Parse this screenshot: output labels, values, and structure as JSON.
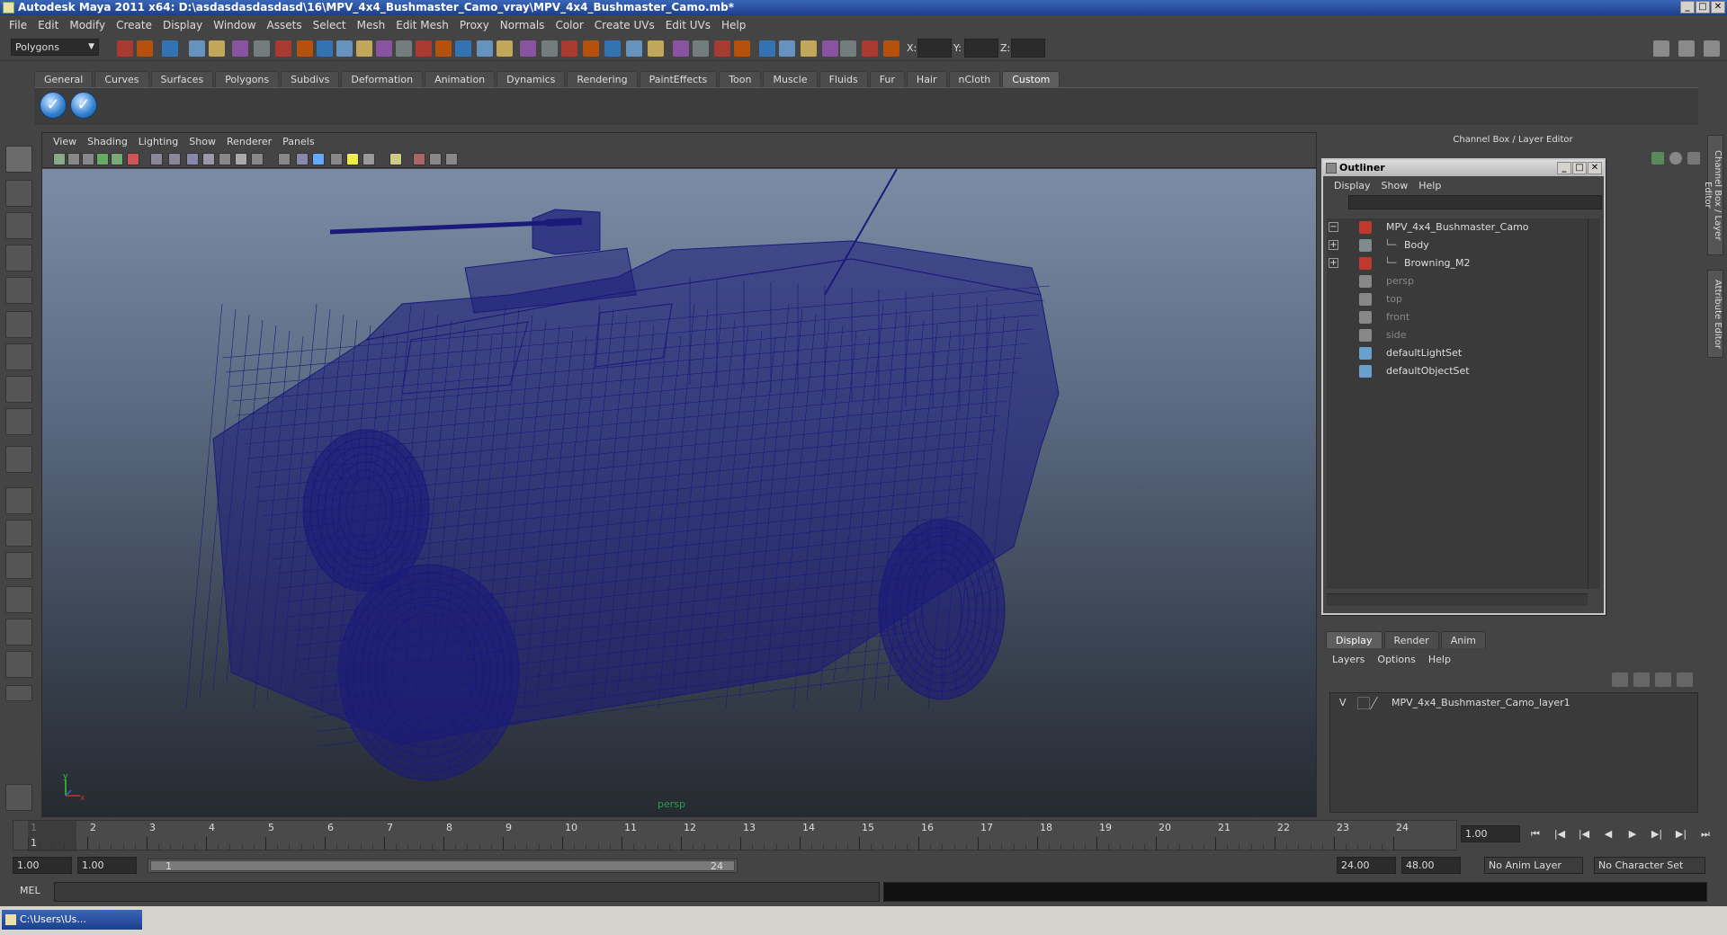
{
  "window": {
    "title": "Autodesk Maya 2011 x64: D:\\asdasdasdasdasd\\16\\MPV_4x4_Bushmaster_Camo_vray\\MPV_4x4_Bushmaster_Camo.mb*",
    "min": "_",
    "max": "□",
    "close": "✕"
  },
  "menubar": [
    "File",
    "Edit",
    "Modify",
    "Create",
    "Display",
    "Window",
    "Assets",
    "Select",
    "Mesh",
    "Edit Mesh",
    "Proxy",
    "Normals",
    "Color",
    "Create UVs",
    "Edit UVs",
    "Help"
  ],
  "status": {
    "mode": "Polygons",
    "x_label": "X:",
    "y_label": "Y:",
    "z_label": "Z:"
  },
  "shelf": {
    "tabs": [
      "General",
      "Curves",
      "Surfaces",
      "Polygons",
      "Subdivs",
      "Deformation",
      "Animation",
      "Dynamics",
      "Rendering",
      "PaintEffects",
      "Toon",
      "Muscle",
      "Fluids",
      "Fur",
      "Hair",
      "nCloth",
      "Custom"
    ],
    "active_tab": "Custom",
    "check_glyph": "✓"
  },
  "viewport": {
    "menu": [
      "View",
      "Shading",
      "Lighting",
      "Show",
      "Renderer",
      "Panels"
    ],
    "camera": "persp",
    "axis_x": "x",
    "axis_y": "y",
    "wire_color": "#1a1a7a"
  },
  "channel_box": {
    "title": "Channel Box / Layer Editor",
    "side_tabs": [
      "Channel Box / Layer Editor",
      "Attribute Editor"
    ]
  },
  "outliner": {
    "title": "Outliner",
    "menu": [
      "Display",
      "Show",
      "Help"
    ],
    "rows": [
      {
        "name": "MPV_4x4_Bushmaster_Camo",
        "expander": "−",
        "dim": false
      },
      {
        "name": "Body",
        "expander": "+",
        "dim": false
      },
      {
        "name": "Browning_M2",
        "expander": "+",
        "dim": false
      },
      {
        "name": "persp",
        "expander": "",
        "dim": true
      },
      {
        "name": "top",
        "expander": "",
        "dim": true
      },
      {
        "name": "front",
        "expander": "",
        "dim": true
      },
      {
        "name": "side",
        "expander": "",
        "dim": true
      },
      {
        "name": "defaultLightSet",
        "expander": "",
        "dim": false
      },
      {
        "name": "defaultObjectSet",
        "expander": "",
        "dim": false
      }
    ]
  },
  "layer_editor": {
    "tabs": [
      "Display",
      "Render",
      "Anim"
    ],
    "active_tab": "Display",
    "menu": [
      "Layers",
      "Options",
      "Help"
    ],
    "layers": [
      {
        "visible": "V",
        "name": "MPV_4x4_Bushmaster_Camo_layer1"
      }
    ]
  },
  "timeline": {
    "ticks": [
      "1",
      "2",
      "3",
      "4",
      "5",
      "6",
      "7",
      "8",
      "9",
      "10",
      "11",
      "12",
      "13",
      "14",
      "15",
      "16",
      "17",
      "18",
      "19",
      "20",
      "21",
      "22",
      "23",
      "24"
    ],
    "current_frame_marker": "1",
    "current_frame": "1.00"
  },
  "range": {
    "start": "1.00",
    "playback_start": "1.00",
    "thumb_start": "1",
    "thumb_end": "24",
    "playback_end": "24.00",
    "end": "48.00",
    "anim_layer": "No Anim Layer",
    "character_set": "No Character Set"
  },
  "command": {
    "label": "MEL"
  },
  "taskbar": {
    "minimized": "C:\\Users\\Us..."
  }
}
